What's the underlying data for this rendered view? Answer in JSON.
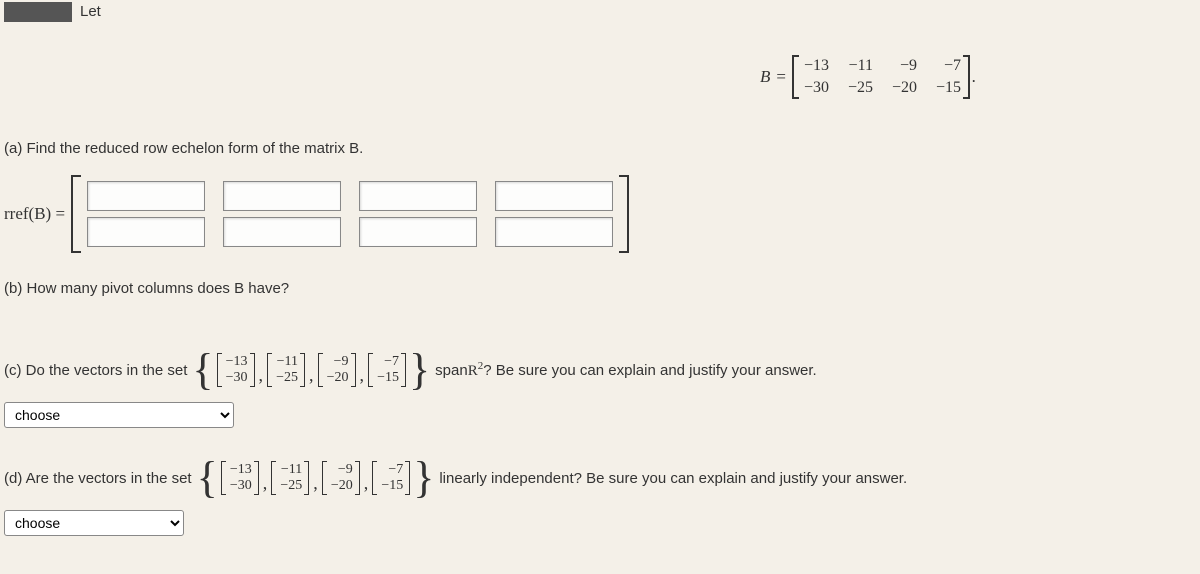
{
  "header": {
    "let": "Let"
  },
  "matrixB": {
    "label": "B",
    "eq": "=",
    "rows": [
      [
        "−13",
        "−11",
        "−9",
        "−7"
      ],
      [
        "−30",
        "−25",
        "−20",
        "−15"
      ]
    ],
    "dot": "."
  },
  "parts": {
    "a": {
      "text": "(a) Find the reduced row echelon form of the matrix B.",
      "rref_label": "rref(B) ="
    },
    "b": {
      "text": "(b) How many pivot columns does B have?"
    },
    "c": {
      "prefix": "(c) Do the vectors in the set ",
      "suffix1": " span ",
      "space": "R",
      "exp": "2",
      "suffix2": "? Be sure you can explain and justify your answer."
    },
    "d": {
      "prefix": "(d) Are the vectors in the set ",
      "suffix": " linearly independent? Be sure you can explain and justify your answer."
    }
  },
  "vectors": [
    {
      "top": "−13",
      "bot": "−30"
    },
    {
      "top": "−11",
      "bot": "−25"
    },
    {
      "top": "−9",
      "bot": "−20"
    },
    {
      "top": "−7",
      "bot": "−15"
    }
  ],
  "select": {
    "placeholder": "choose"
  }
}
